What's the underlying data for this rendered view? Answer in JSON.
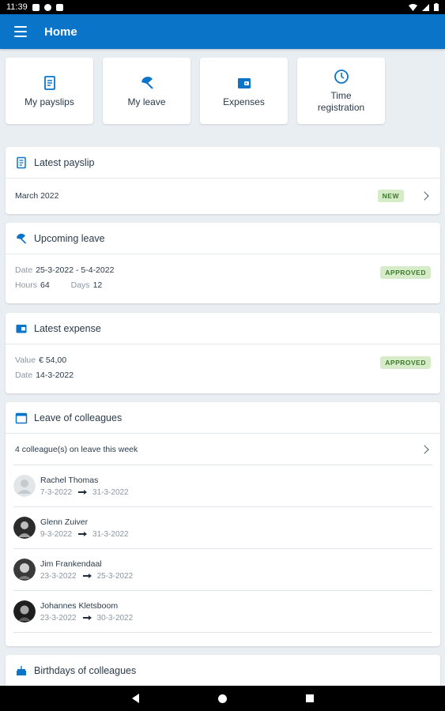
{
  "status_bar": {
    "time": "11:39"
  },
  "app_bar": {
    "title": "Home",
    "menu_icon": "hamburger-menu-icon"
  },
  "colors": {
    "primary": "#0a74c9",
    "badge_bg": "#d6ecc9",
    "badge_text": "#3c7a2a",
    "background": "#e9eef3"
  },
  "tiles": [
    {
      "label": "My payslips",
      "icon": "payslip-icon"
    },
    {
      "label": "My leave",
      "icon": "umbrella-icon"
    },
    {
      "label": "Expenses",
      "icon": "wallet-icon"
    },
    {
      "label": "Time registration",
      "icon": "clock-icon"
    }
  ],
  "latest_payslip": {
    "title": "Latest payslip",
    "month": "March 2022",
    "badge": "NEW"
  },
  "upcoming_leave": {
    "title": "Upcoming leave",
    "date_label": "Date",
    "date_value": "25-3-2022 - 5-4-2022",
    "hours_label": "Hours",
    "hours_value": "64",
    "days_label": "Days",
    "days_value": "12",
    "badge": "APPROVED"
  },
  "latest_expense": {
    "title": "Latest expense",
    "value_label": "Value",
    "value_value": "€ 54,00",
    "date_label": "Date",
    "date_value": "14-3-2022",
    "badge": "APPROVED"
  },
  "leave_of_colleagues": {
    "title": "Leave of colleagues",
    "summary": "4 colleague(s) on leave this week",
    "colleagues": [
      {
        "name": "Rachel Thomas",
        "from": "7-3-2022",
        "to": "31-3-2022"
      },
      {
        "name": "Glenn Zuiver",
        "from": "9-3-2022",
        "to": "31-3-2022"
      },
      {
        "name": "Jim Frankendaal",
        "from": "23-3-2022",
        "to": "25-3-2022"
      },
      {
        "name": "Johannes Kletsboom",
        "from": "23-3-2022",
        "to": "30-3-2022"
      }
    ]
  },
  "birthdays": {
    "title": "Birthdays of colleagues"
  }
}
